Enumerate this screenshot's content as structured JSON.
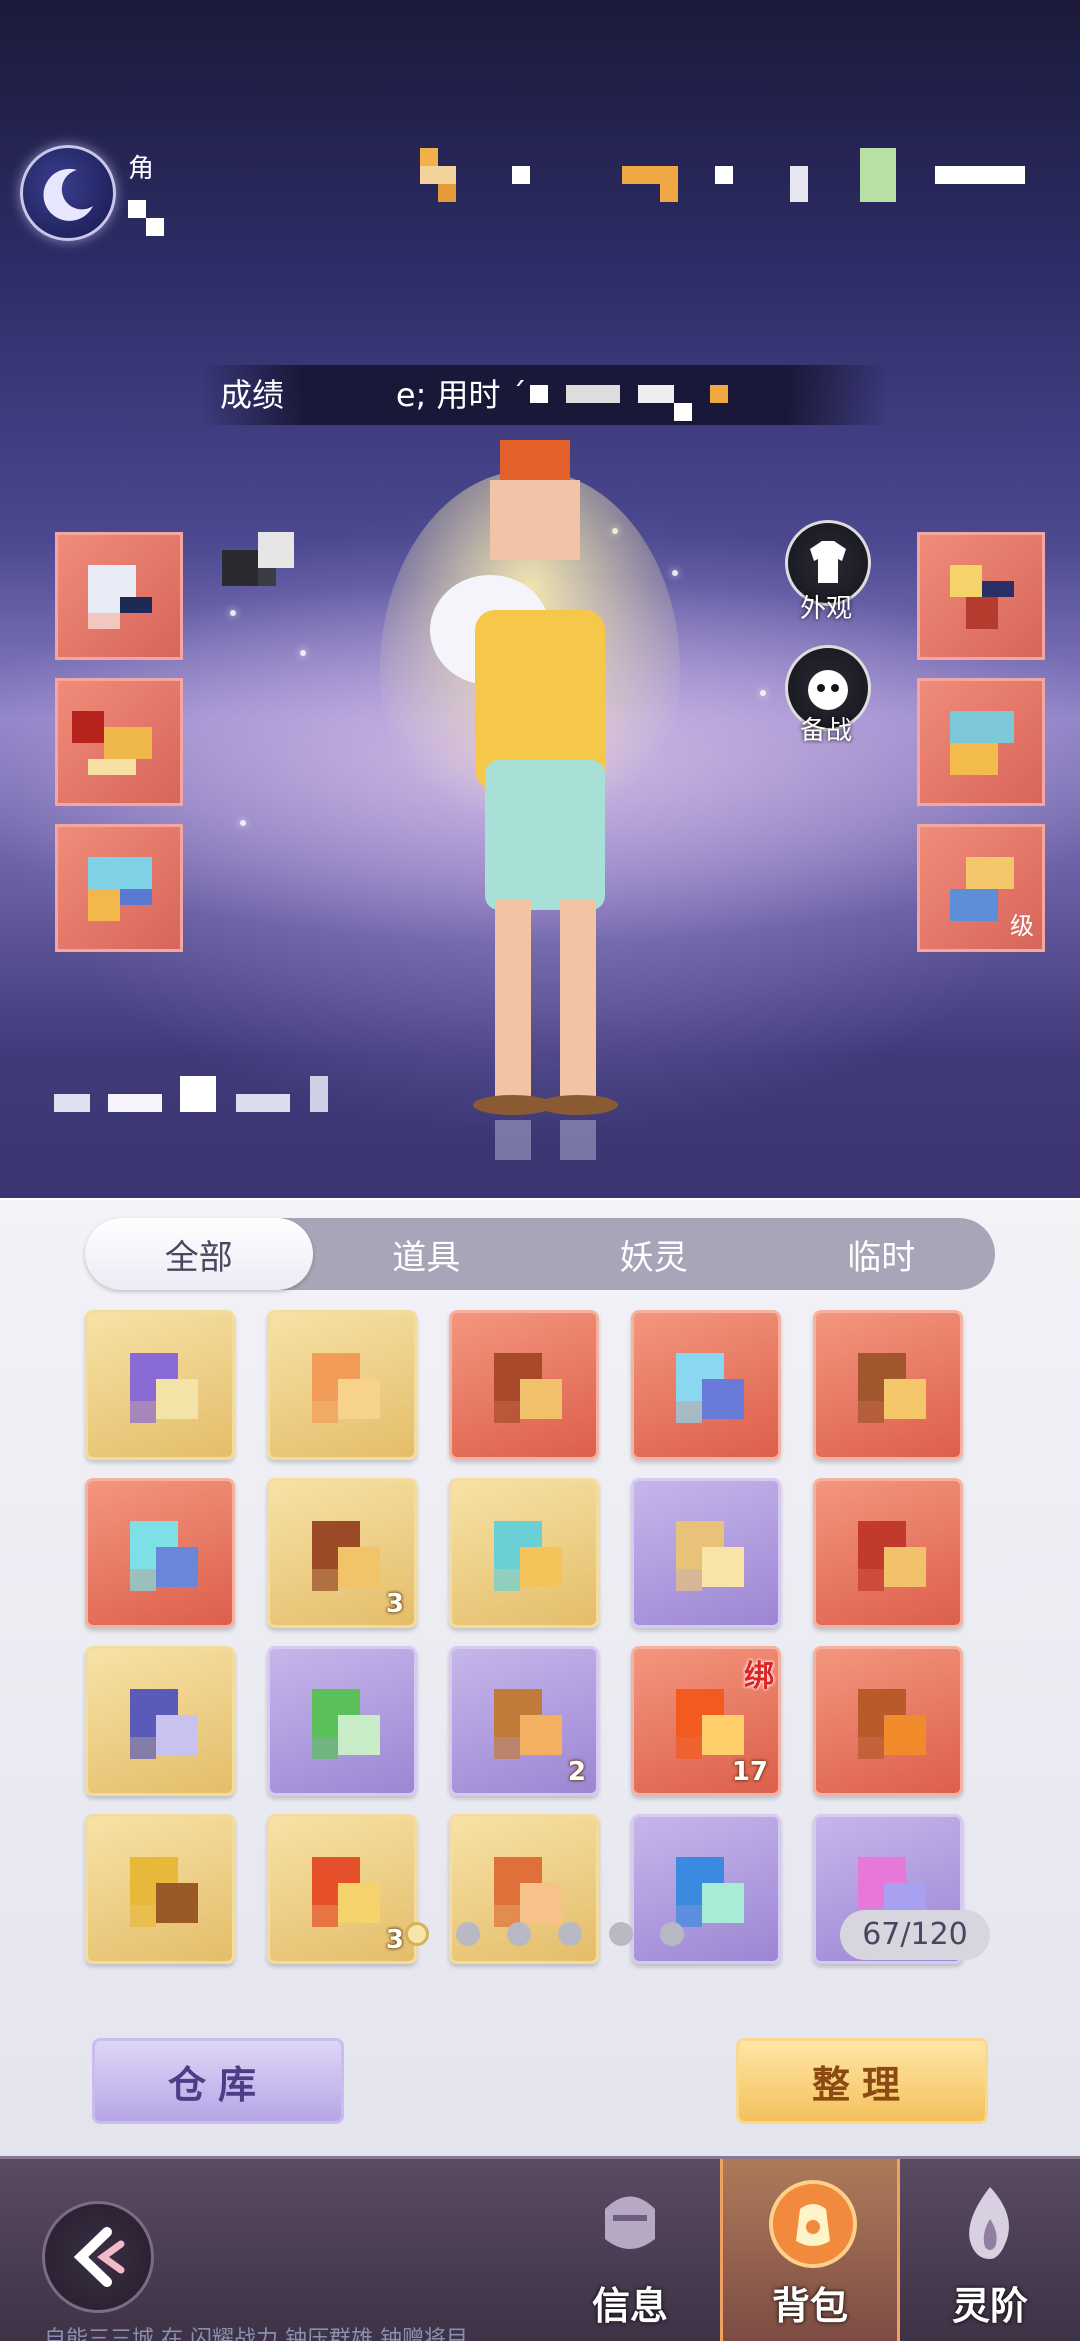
{
  "player": {
    "name_label": "角",
    "title_bar": "成绩           e; 用时 ´"
  },
  "side_buttons": {
    "appearance": "外观",
    "backup": "备战",
    "level_hint": "级"
  },
  "tabs": [
    {
      "label": "全部",
      "active": true
    },
    {
      "label": "道具",
      "active": false
    },
    {
      "label": "妖灵",
      "active": false
    },
    {
      "label": "临时",
      "active": false
    }
  ],
  "items": [
    {
      "bg": "gold",
      "icon": "purple-crescent-icon",
      "count": ""
    },
    {
      "bg": "gold",
      "icon": "orange-orb-icon",
      "count": ""
    },
    {
      "bg": "red",
      "icon": "mixed-box-icon",
      "count": ""
    },
    {
      "bg": "red",
      "icon": "blue-crystal-icon",
      "count": ""
    },
    {
      "bg": "red",
      "icon": "brown-pouch-icon",
      "count": ""
    },
    {
      "bg": "red",
      "icon": "cyan-gem-icon",
      "count": ""
    },
    {
      "bg": "gold",
      "icon": "brown-scroll-icon",
      "count": "3"
    },
    {
      "bg": "gold",
      "icon": "teal-gem-icon",
      "count": ""
    },
    {
      "bg": "purple",
      "icon": "tan-bag-icon",
      "count": ""
    },
    {
      "bg": "red",
      "icon": "red-chest-icon",
      "count": ""
    },
    {
      "bg": "gold",
      "icon": "gift-box-icon",
      "count": ""
    },
    {
      "bg": "purple",
      "icon": "green-leaf-icon",
      "count": ""
    },
    {
      "bg": "purple",
      "icon": "amber-potion-icon",
      "count": "2"
    },
    {
      "bg": "red",
      "icon": "fire-orb-icon",
      "count": "17",
      "bind": "绑"
    },
    {
      "bg": "red",
      "icon": "orange-relic-icon",
      "count": ""
    },
    {
      "bg": "gold",
      "icon": "yellow-charm-icon",
      "count": ""
    },
    {
      "bg": "gold",
      "icon": "red-flame-icon",
      "count": "3"
    },
    {
      "bg": "gold",
      "icon": "orange-pack-icon",
      "count": ""
    },
    {
      "bg": "purple",
      "icon": "sky-orb-icon",
      "count": ""
    },
    {
      "bg": "purple",
      "icon": "pink-crystal-icon",
      "count": ""
    }
  ],
  "pager": {
    "pages": 6,
    "current": 1
  },
  "capacity": "67/120",
  "buttons": {
    "warehouse": "仓库",
    "sort": "整理"
  },
  "nav": {
    "info": "信息",
    "bag": "背包",
    "rank": "灵阶"
  },
  "ticker": "自能三三城 在 闪耀战力 钟压群雄 钟赠将目"
}
